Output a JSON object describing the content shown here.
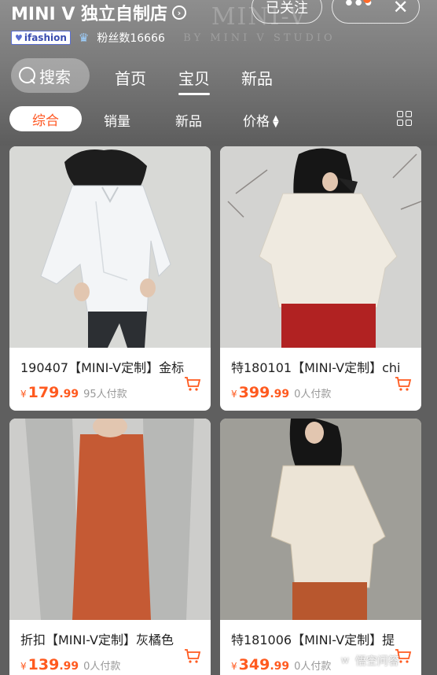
{
  "header": {
    "shop_name": "MINI V 独立自制店",
    "watermark_big": "MINI-V",
    "watermark_small": "BY MINI V STUDIO",
    "follow_label": "已关注",
    "more_label": "•••",
    "close_label": "✕",
    "badge_label": "ifashion",
    "fans_label": "粉丝数16666"
  },
  "nav": {
    "search_label": "搜索",
    "tabs": [
      {
        "label": "首页",
        "active": false
      },
      {
        "label": "宝贝",
        "active": true
      },
      {
        "label": "新品",
        "active": false
      }
    ]
  },
  "sort": {
    "items": [
      "综合",
      "销量",
      "新品",
      "价格"
    ],
    "active": "综合",
    "sort_arrows": "▲▼"
  },
  "products": [
    {
      "title": "190407【MINI-V定制】金标",
      "currency": "¥",
      "price_int": "179",
      "price_dec": ".99",
      "sold": "95人付款"
    },
    {
      "title": "特180101【MINI-V定制】chi",
      "currency": "¥",
      "price_int": "399",
      "price_dec": ".99",
      "sold": "0人付款"
    },
    {
      "title": "折扣【MINI-V定制】灰橘色",
      "currency": "¥",
      "price_int": "139",
      "price_dec": ".99",
      "sold": "0人付款"
    },
    {
      "title": "特181006【MINI-V定制】提",
      "currency": "¥",
      "price_int": "349",
      "price_dec": ".99",
      "sold": "0人付款"
    }
  ],
  "footer": {
    "watermark": "悟空问答"
  },
  "colors": {
    "accent": "#ff5a1f",
    "header_bg": "#7a7a7a",
    "card_bg": "#ffffff"
  }
}
